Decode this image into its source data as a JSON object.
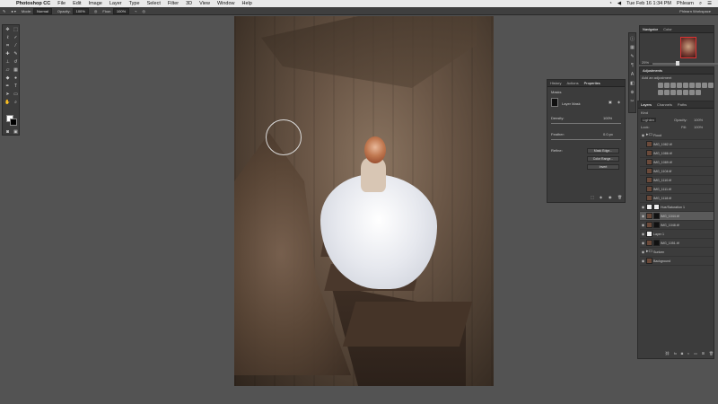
{
  "menubar": {
    "apple": "",
    "items": [
      "Photoshop CC",
      "File",
      "Edit",
      "Image",
      "Layer",
      "Type",
      "Select",
      "Filter",
      "3D",
      "View",
      "Window",
      "Help"
    ],
    "clock": "Tue Feb 16  1:34 PM",
    "user": "Phlearn"
  },
  "options": {
    "mode_label": "Mode:",
    "mode_value": "Normal",
    "opacity_label": "Opacity:",
    "opacity_value": "100%",
    "flow_label": "Flow:",
    "flow_value": "100%",
    "workspace": "Phlearn Workspace"
  },
  "navigator": {
    "tabs": [
      "Navigator",
      "Color"
    ],
    "zoom": "25%"
  },
  "adjustments": {
    "title": "Adjustments",
    "subtitle": "Add an adjustment"
  },
  "properties": {
    "tabs": [
      "History",
      "Actions",
      "Properties"
    ],
    "section": "Masks",
    "mask_label": "Layer Mask",
    "density_label": "Density:",
    "density_value": "100%",
    "feather_label": "Feather:",
    "feather_value": "0.0 px",
    "refine_label": "Refine:",
    "buttons": [
      "Mask Edge...",
      "Color Range...",
      "Invert"
    ]
  },
  "layers": {
    "tabs": [
      "Layers",
      "Channels",
      "Paths"
    ],
    "kind": "Kind",
    "blend": "Lighten",
    "opacity_label": "Opacity:",
    "opacity_value": "100%",
    "fill_label": "Fill:",
    "fill_value": "100%",
    "lock_label": "Lock:",
    "rows": [
      {
        "name": "Flood",
        "type": "folder"
      },
      {
        "name": "IMG_1082.tif",
        "type": "image"
      },
      {
        "name": "IMG_1086.tif",
        "type": "image"
      },
      {
        "name": "IMG_1089.tif",
        "type": "image"
      },
      {
        "name": "IMG_1104.tif",
        "type": "image"
      },
      {
        "name": "IMG_1110.tif",
        "type": "image"
      },
      {
        "name": "IMG_1111.tif",
        "type": "image"
      },
      {
        "name": "IMG_1118.tif",
        "type": "image"
      },
      {
        "name": "Hue/Saturation 1",
        "type": "adjust"
      },
      {
        "name": "IMG_1044.tif",
        "type": "image-mask",
        "selected": true
      },
      {
        "name": "IMG_1048.tif",
        "type": "image-mask"
      },
      {
        "name": "Layer 1",
        "type": "image-white"
      },
      {
        "name": "IMG_1051.tif",
        "type": "image-mask"
      },
      {
        "name": "Sunken",
        "type": "folder"
      },
      {
        "name": "Background",
        "type": "image"
      }
    ]
  }
}
